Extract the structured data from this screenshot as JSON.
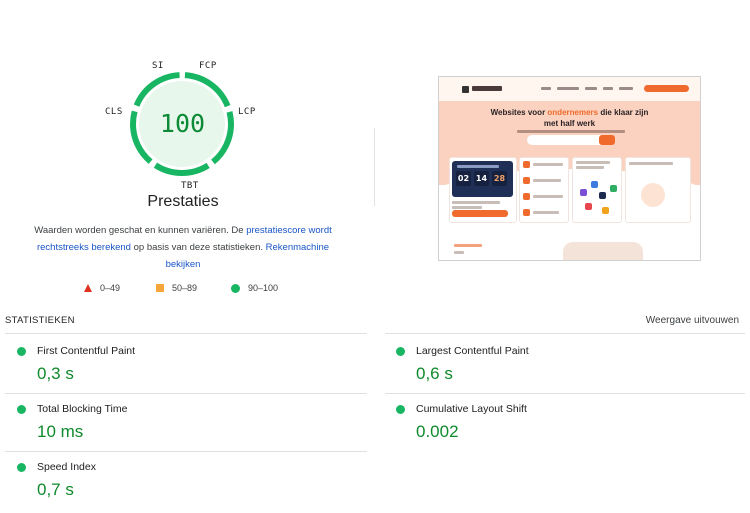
{
  "gauge": {
    "score": "100",
    "labels": {
      "si": "SI",
      "fcp": "FCP",
      "lcp": "LCP",
      "cls": "CLS",
      "tbt": "TBT"
    },
    "title": "Prestaties",
    "color": "#18b663"
  },
  "description": {
    "text1": "Waarden worden geschat en kunnen variëren. De ",
    "link1": "prestatiescore wordt rechtstreeks berekend",
    "text2": " op basis van deze statistieken. ",
    "link2": "Rekenmachine bekijken"
  },
  "legend": {
    "fail": "0–49",
    "average": "50–89",
    "pass": "90–100"
  },
  "screenshot": {
    "headline_part1": "Websites voor ",
    "headline_accent": "ondernemers",
    "headline_part2": " die klaar zijn",
    "headline_line2": "met half werk",
    "timer": [
      "02",
      "14",
      "28"
    ]
  },
  "stats": {
    "heading": "STATISTIEKEN",
    "toggle": "Weergave uitvouwen",
    "items": [
      {
        "name": "First Contentful Paint",
        "value": "0,3 s",
        "status": "pass"
      },
      {
        "name": "Largest Contentful Paint",
        "value": "0,6 s",
        "status": "pass"
      },
      {
        "name": "Total Blocking Time",
        "value": "10 ms",
        "status": "pass"
      },
      {
        "name": "Cumulative Layout Shift",
        "value": "0.002",
        "status": "pass"
      },
      {
        "name": "Speed Index",
        "value": "0,7 s",
        "status": "pass"
      }
    ]
  },
  "colors": {
    "pass": "#18b663",
    "average": "#f6a638",
    "fail": "#e0301e",
    "link": "#1a56c8"
  }
}
